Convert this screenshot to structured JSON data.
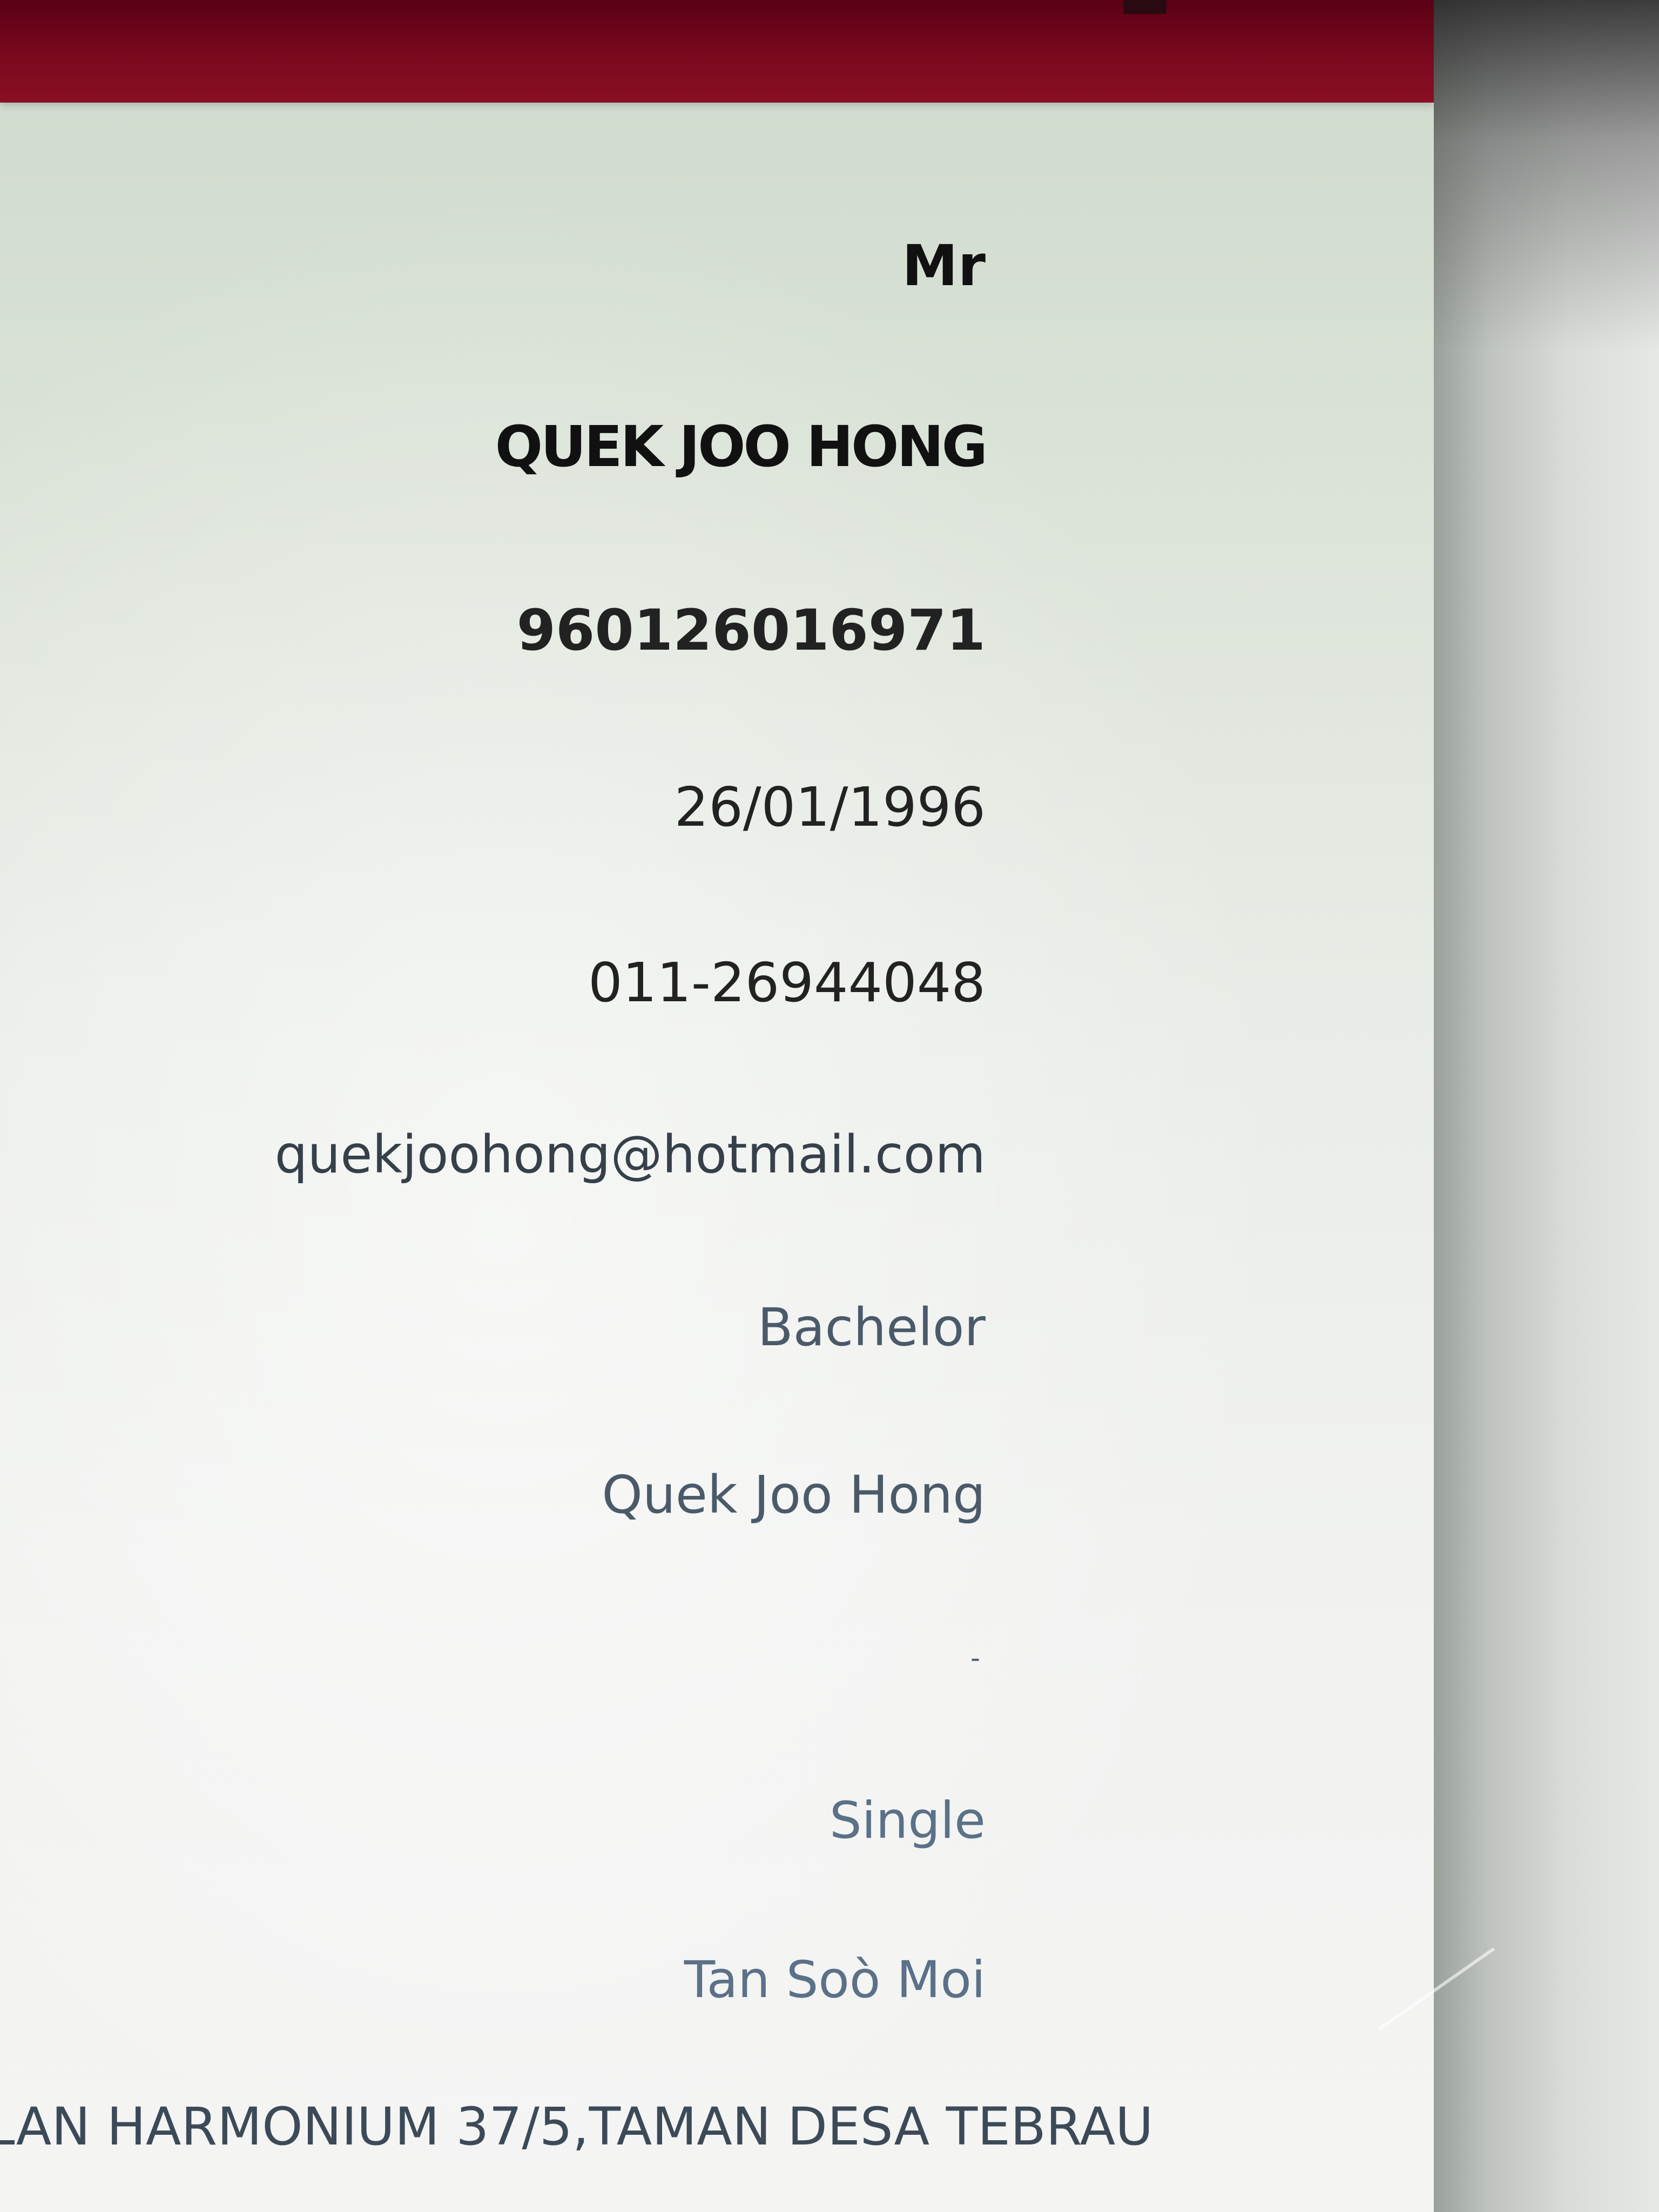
{
  "profile": {
    "title": "Mr",
    "full_name": "QUEK JOO HONG",
    "ic_number": "960126016971",
    "date_of_birth": "26/01/1996",
    "phone": "011-26944048",
    "email": "quekjoohong@hotmail.com",
    "education": "Bachelor",
    "account_name": "Quek Joo Hong",
    "empty_field": "-",
    "marital_status": "Single",
    "mother_name": "Tan Soò Moi",
    "address_line": "LAN HARMONIUM 37/5,TAMAN DESA TEBRAU"
  },
  "colors": {
    "header": "#7c0a1f",
    "text_dark": "#111111",
    "text_light": "#5a7188"
  }
}
